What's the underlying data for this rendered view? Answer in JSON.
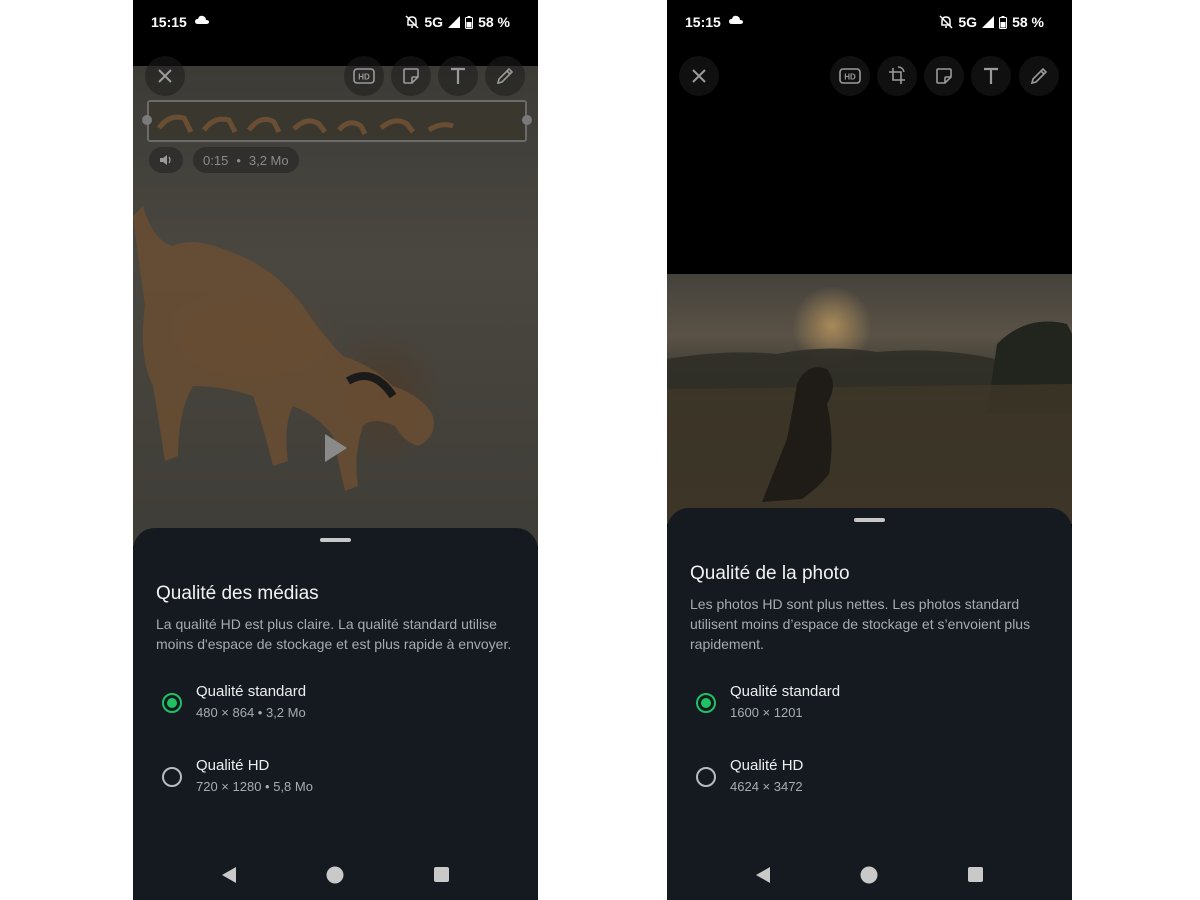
{
  "status_bar": {
    "time": "15:15",
    "network": "5G",
    "battery": "58 %"
  },
  "left_screen": {
    "video_info": {
      "duration": "0:15",
      "separator": "•",
      "size": "3,2 Mo"
    },
    "sheet": {
      "title": "Qualité des médias",
      "description": "La qualité HD est plus claire. La qualité standard utilise moins d'espace de stockage et est plus rapide à envoyer.",
      "options": [
        {
          "label": "Qualité standard",
          "detail": "480 × 864 • 3,2 Mo",
          "selected": true
        },
        {
          "label": "Qualité HD",
          "detail": "720 × 1280 • 5,8 Mo",
          "selected": false
        }
      ]
    }
  },
  "right_screen": {
    "sheet": {
      "title": "Qualité de la photo",
      "description": "Les photos HD sont plus nettes. Les photos standard utilisent moins d’espace de stockage et s’envoient plus rapidement.",
      "options": [
        {
          "label": "Qualité standard",
          "detail": "1600 × 1201",
          "selected": true
        },
        {
          "label": "Qualité HD",
          "detail": "4624 × 3472",
          "selected": false
        }
      ]
    }
  },
  "toolbar": {
    "hd_badge": "HD",
    "text_tool": "T"
  },
  "colors": {
    "accent": "#21c063",
    "sheet_bg": "#141a1f"
  }
}
